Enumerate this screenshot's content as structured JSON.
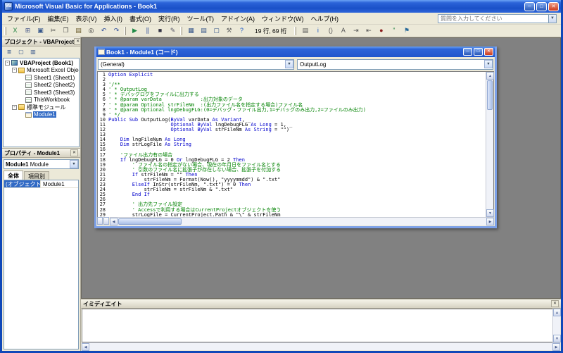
{
  "window": {
    "title": "Microsoft Visual Basic for Applications - Book1"
  },
  "menu": {
    "items": [
      "ファイル(F)",
      "編集(E)",
      "表示(V)",
      "挿入(I)",
      "書式(O)",
      "実行(R)",
      "ツール(T)",
      "アドイン(A)",
      "ウィンドウ(W)",
      "ヘルプ(H)"
    ],
    "question_placeholder": "質問を入力してください"
  },
  "toolbar": {
    "position_text": "19 行, 69 桁",
    "groups": [
      [
        {
          "name": "view-excel-icon",
          "glyph": "X",
          "color": "#1a7f3c"
        },
        {
          "name": "insert-userform-icon",
          "glyph": "⊞",
          "color": "#4a5a8a"
        },
        {
          "name": "save-icon",
          "glyph": "▣",
          "color": "#35558a"
        },
        {
          "name": "cut-icon",
          "glyph": "✂",
          "color": "#444444"
        },
        {
          "name": "copy-icon",
          "glyph": "❐",
          "color": "#444444"
        },
        {
          "name": "paste-icon",
          "glyph": "▤",
          "color": "#6a5a2a"
        },
        {
          "name": "find-icon",
          "glyph": "◎",
          "color": "#333333"
        },
        {
          "name": "undo-icon",
          "glyph": "↶",
          "color": "#2a4a9a"
        },
        {
          "name": "redo-icon",
          "glyph": "↷",
          "color": "#2a4a9a"
        }
      ],
      [
        {
          "name": "run-icon",
          "glyph": "▶",
          "color": "#1f8a46"
        },
        {
          "name": "break-icon",
          "glyph": "∥",
          "color": "#2a4a9a"
        },
        {
          "name": "reset-icon",
          "glyph": "■",
          "color": "#333344"
        },
        {
          "name": "design-mode-icon",
          "glyph": "✎",
          "color": "#555566"
        }
      ],
      [
        {
          "name": "project-explorer-icon",
          "glyph": "▦",
          "color": "#35558a"
        },
        {
          "name": "properties-window-icon",
          "glyph": "▤",
          "color": "#35558a"
        },
        {
          "name": "object-browser-icon",
          "glyph": "▢",
          "color": "#35558a"
        },
        {
          "name": "toolbox-icon",
          "glyph": "⚒",
          "color": "#666666"
        },
        {
          "name": "help-icon",
          "glyph": "?",
          "color": "#1a56c4"
        }
      ],
      [
        {
          "name": "list-properties-icon",
          "glyph": "▤",
          "color": "#555555"
        },
        {
          "name": "quick-info-icon",
          "glyph": "i",
          "color": "#1a56c4"
        },
        {
          "name": "parameter-info-icon",
          "glyph": "()",
          "color": "#555555"
        },
        {
          "name": "complete-word-icon",
          "glyph": "A",
          "color": "#555555"
        },
        {
          "name": "indent-icon",
          "glyph": "⇥",
          "color": "#555555"
        },
        {
          "name": "outdent-icon",
          "glyph": "⇤",
          "color": "#555555"
        },
        {
          "name": "toggle-breakpoint-icon",
          "glyph": "●",
          "color": "#8a1a1a"
        },
        {
          "name": "comment-block-icon",
          "glyph": "”",
          "color": "#1a7f3c"
        },
        {
          "name": "bookmark-icon",
          "glyph": "⚑",
          "color": "#2a6a9a"
        }
      ]
    ]
  },
  "project": {
    "title": "プロジェクト - VBAProject",
    "toolbar": [
      {
        "name": "view-code-button",
        "glyph": "≣"
      },
      {
        "name": "view-object-button",
        "glyph": "▢"
      },
      {
        "name": "toggle-folders-button",
        "glyph": "▥"
      }
    ],
    "tree": [
      {
        "label": "VBAProject (Book1)",
        "icon": "project",
        "expander": "-",
        "bold": true,
        "indent": 0
      },
      {
        "label": "Microsoft Excel Object",
        "icon": "folder",
        "expander": "-",
        "indent": 1
      },
      {
        "label": "Sheet1 (Sheet1)",
        "icon": "sheet",
        "indent": 2
      },
      {
        "label": "Sheet2 (Sheet2)",
        "icon": "sheet",
        "indent": 2
      },
      {
        "label": "Sheet3 (Sheet3)",
        "icon": "sheet",
        "indent": 2
      },
      {
        "label": "ThisWorkbook",
        "icon": "sheet",
        "indent": 2
      },
      {
        "label": "標準モジュール",
        "icon": "folder",
        "expander": "-",
        "indent": 1
      },
      {
        "label": "Module1",
        "icon": "module",
        "indent": 2,
        "selected": true
      }
    ]
  },
  "properties": {
    "title": "プロパティ - Module1",
    "object_name": "Module1",
    "object_type": "Module",
    "tabs": [
      "全体",
      "項目別"
    ],
    "rows": [
      {
        "name": "(オブジェクト名)",
        "value": "Module1"
      }
    ]
  },
  "code_window": {
    "title": "Book1 - Module1 (コード)",
    "left_combo": "(General)",
    "right_combo": "OutputLog",
    "lines": [
      {
        "n": 1,
        "s": [
          [
            "k",
            "Option Explicit"
          ]
        ]
      },
      {
        "n": 2,
        "s": []
      },
      {
        "n": 3,
        "s": [
          [
            "c",
            "'/**"
          ]
        ]
      },
      {
        "n": 4,
        "s": [
          [
            "c",
            "' * OutputLog"
          ]
        ]
      },
      {
        "n": 5,
        "s": [
          [
            "c",
            "' * デバッグログをファイルに出力する"
          ]
        ]
      },
      {
        "n": 6,
        "s": [
          [
            "c",
            "' * @param varData             :出力対象のデータ"
          ]
        ]
      },
      {
        "n": 7,
        "s": [
          [
            "c",
            "' * @param Optional strFileNm  :(出力ファイル名を指定する場合)ファイル名"
          ]
        ]
      },
      {
        "n": 8,
        "s": [
          [
            "c",
            "' * @param Optional lngDebugFLG:(0=デバッグ・ファイル出力,1=デバッグのみ出力,2=ファイルのみ出力)"
          ]
        ]
      },
      {
        "n": 9,
        "s": [
          [
            "c",
            "' */"
          ]
        ]
      },
      {
        "n": 10,
        "s": [
          [
            "k",
            "Public Sub"
          ],
          [
            "t",
            " OutputLog("
          ],
          [
            "k",
            "ByVal"
          ],
          [
            "t",
            " varData "
          ],
          [
            "k",
            "As Variant"
          ],
          [
            "t",
            ", _"
          ]
        ]
      },
      {
        "n": 11,
        "s": [
          [
            "t",
            "                     "
          ],
          [
            "k",
            "Optional ByVal"
          ],
          [
            "t",
            " lngDebugFLG "
          ],
          [
            "k",
            "As Long"
          ],
          [
            "t",
            " = 1, _"
          ]
        ]
      },
      {
        "n": 12,
        "s": [
          [
            "t",
            "                     "
          ],
          [
            "k",
            "Optional ByVal"
          ],
          [
            "t",
            " strFileNm "
          ],
          [
            "k",
            "As String"
          ],
          [
            "t",
            " = \"\")"
          ]
        ]
      },
      {
        "n": 13,
        "s": []
      },
      {
        "n": 14,
        "s": [
          [
            "t",
            "    "
          ],
          [
            "k",
            "Dim"
          ],
          [
            "t",
            " lngFileNum "
          ],
          [
            "k",
            "As Long"
          ]
        ]
      },
      {
        "n": 15,
        "s": [
          [
            "t",
            "    "
          ],
          [
            "k",
            "Dim"
          ],
          [
            "t",
            " strLogFile "
          ],
          [
            "k",
            "As String"
          ]
        ]
      },
      {
        "n": 16,
        "s": []
      },
      {
        "n": 17,
        "s": [
          [
            "c",
            "    'ファイル出力有の場合"
          ]
        ]
      },
      {
        "n": 18,
        "s": [
          [
            "t",
            "    "
          ],
          [
            "k",
            "If"
          ],
          [
            "t",
            " lngDebugFLG = 0 "
          ],
          [
            "k",
            "Or"
          ],
          [
            "t",
            " lngDebugFLG = 2 "
          ],
          [
            "k",
            "Then"
          ]
        ]
      },
      {
        "n": 19,
        "s": [
          [
            "c",
            "        ' ファイル名の指定がない場合、現在の年月日をファイル名とする"
          ]
        ]
      },
      {
        "n": 20,
        "s": [
          [
            "c",
            "        ' 引数のファイル名に拡張子が存在しない場合、拡張子を付加する"
          ]
        ]
      },
      {
        "n": 21,
        "s": [
          [
            "t",
            "        "
          ],
          [
            "k",
            "If"
          ],
          [
            "t",
            " strFileNm = \"\" "
          ],
          [
            "k",
            "Then"
          ]
        ]
      },
      {
        "n": 22,
        "s": [
          [
            "t",
            "            strFileNm = Format(Now(), \"yyyymmdd\") & \".txt\""
          ]
        ]
      },
      {
        "n": 23,
        "s": [
          [
            "t",
            "        "
          ],
          [
            "k",
            "ElseIf"
          ],
          [
            "t",
            " InStr(strFileNm, \".txt\") = 0 "
          ],
          [
            "k",
            "Then"
          ]
        ]
      },
      {
        "n": 24,
        "s": [
          [
            "t",
            "            strFileNm = strFileNm & \".txt\""
          ]
        ]
      },
      {
        "n": 25,
        "s": [
          [
            "t",
            "        "
          ],
          [
            "k",
            "End If"
          ]
        ]
      },
      {
        "n": 26,
        "s": []
      },
      {
        "n": 27,
        "s": [
          [
            "c",
            "        ' 出力先ファイル設定"
          ]
        ]
      },
      {
        "n": 28,
        "s": [
          [
            "c",
            "        ' Accessで利用する場合はCurrentProjectオブジェクトを使う"
          ]
        ]
      },
      {
        "n": 29,
        "s": [
          [
            "t",
            "        strLogFile = CurrentProject.Path & \"\\\" & strFileNm"
          ]
        ]
      }
    ]
  },
  "immediate": {
    "title": "イミディエイト"
  },
  "colors": {
    "titlebar": "#2b63d8",
    "keyword": "#0000cc",
    "comment": "#008200",
    "selection": "#316ac5",
    "mdi_background": "#818181"
  }
}
